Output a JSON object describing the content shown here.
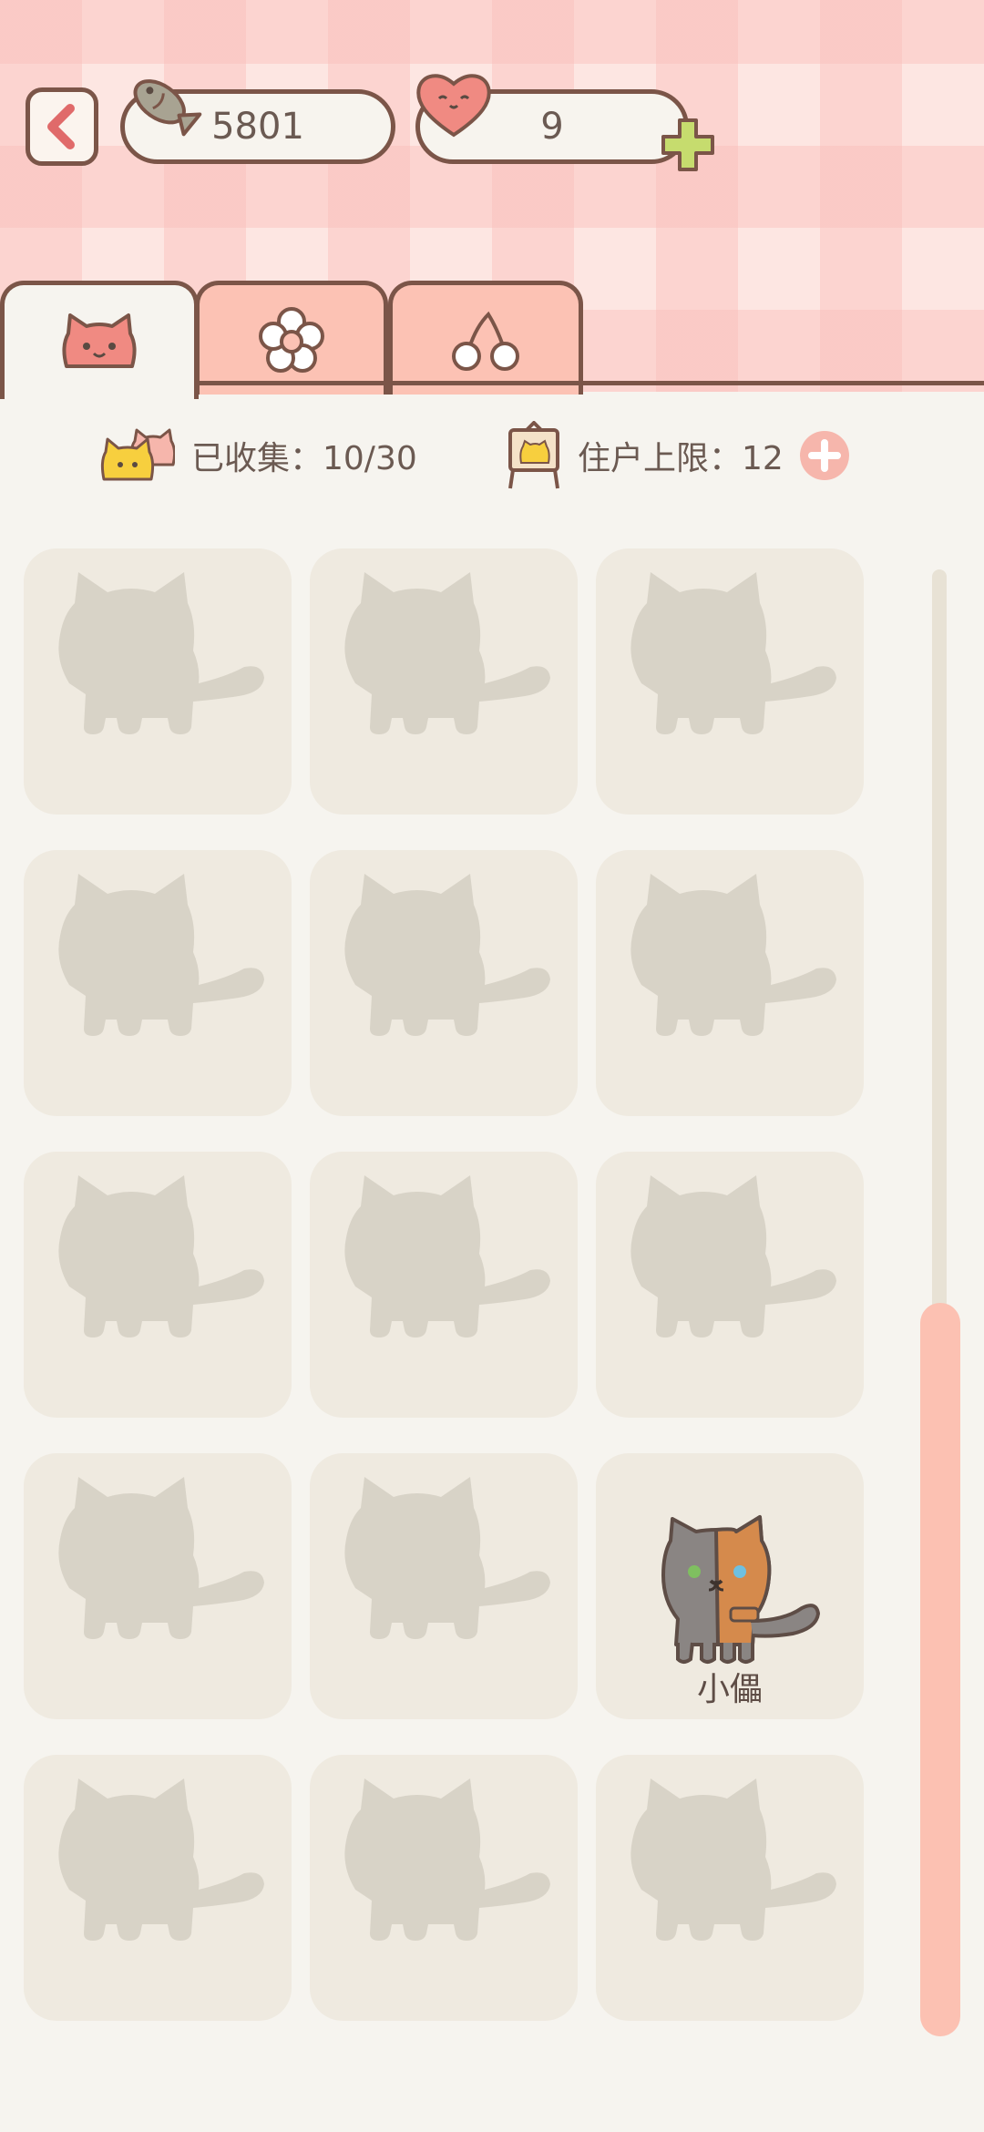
{
  "header": {
    "fish_count": "5801",
    "heart_count": "9"
  },
  "tabs": [
    {
      "name": "cats-tab",
      "icon": "cat-face-icon",
      "active": true
    },
    {
      "name": "flower-tab",
      "icon": "flower-icon",
      "active": false
    },
    {
      "name": "cherry-tab",
      "icon": "cherry-icon",
      "active": false
    }
  ],
  "stats": {
    "collected": "已收集：10/30",
    "resident_limit": "住户上限：12"
  },
  "cats": [
    {
      "unlocked": false
    },
    {
      "unlocked": false
    },
    {
      "unlocked": false
    },
    {
      "unlocked": false
    },
    {
      "unlocked": false
    },
    {
      "unlocked": false
    },
    {
      "unlocked": false
    },
    {
      "unlocked": false
    },
    {
      "unlocked": false
    },
    {
      "unlocked": false
    },
    {
      "unlocked": false
    },
    {
      "unlocked": true,
      "name": "小儡"
    },
    {
      "unlocked": false
    },
    {
      "unlocked": false
    },
    {
      "unlocked": false
    }
  ],
  "colors": {
    "accent_pink": "#fcc2b4",
    "outline_brown": "#7b5548",
    "card_bg": "#efeae0",
    "silhouette": "#d8d3c7",
    "plus_green": "#c6dc6e"
  }
}
